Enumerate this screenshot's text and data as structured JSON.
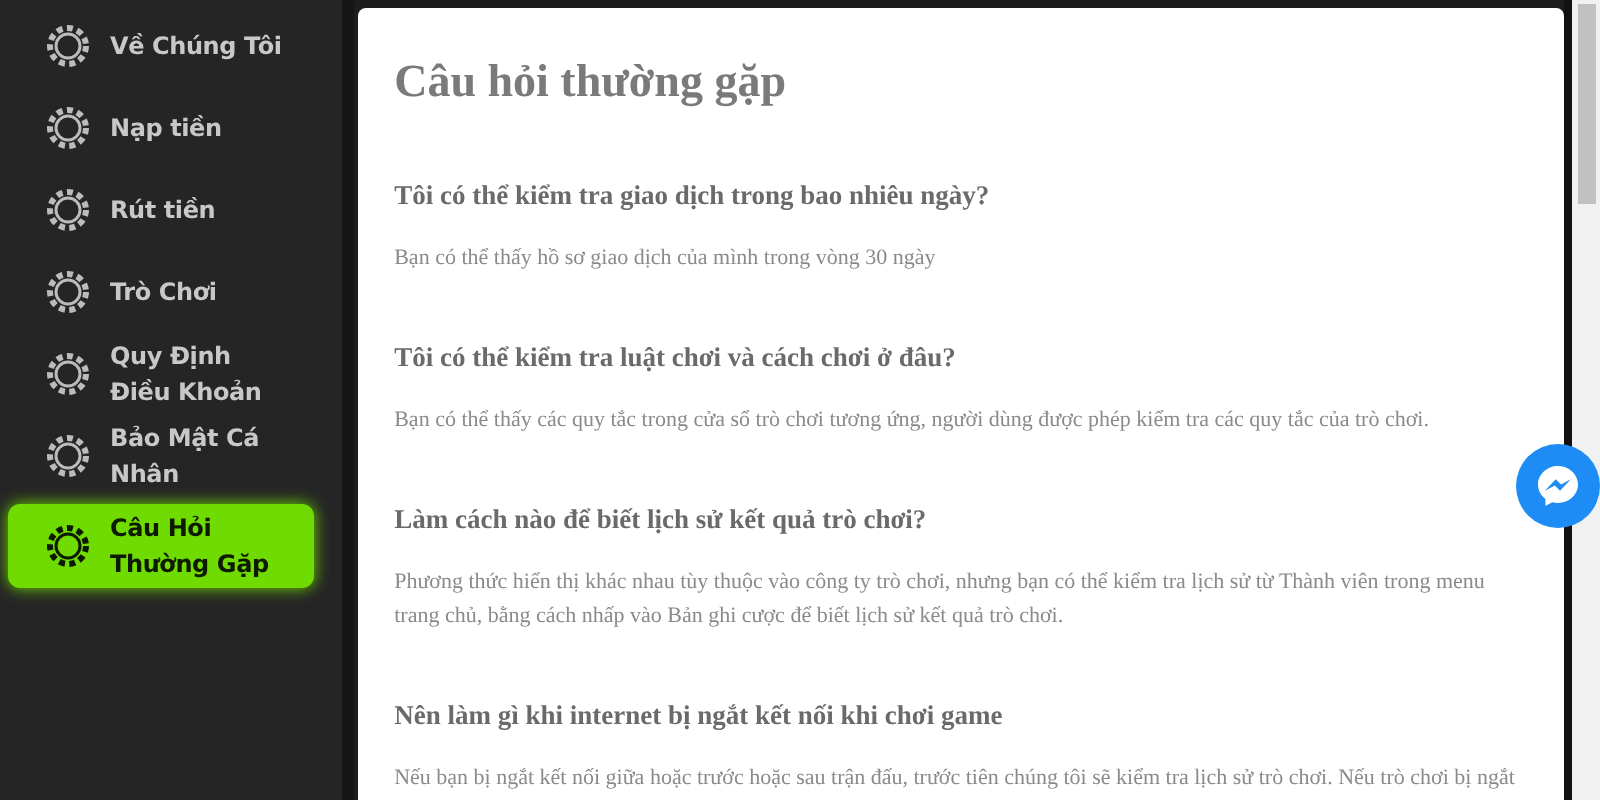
{
  "sidebar": {
    "items": [
      {
        "label": "Về Chúng Tôi",
        "selected": false
      },
      {
        "label": "Nạp tiền",
        "selected": false
      },
      {
        "label": "Rút tiền",
        "selected": false
      },
      {
        "label": "Trò Chơi",
        "selected": false
      },
      {
        "label": "Quy Định Điều Khoản",
        "selected": false
      },
      {
        "label": "Bảo Mật Cá Nhân",
        "selected": false
      },
      {
        "label": "Câu Hỏi Thường Gặp",
        "selected": true
      }
    ]
  },
  "content": {
    "title": "Câu hỏi thường gặp",
    "faqs": [
      {
        "question": "Tôi có thể kiểm tra giao dịch trong bao nhiêu ngày?",
        "answer": "Bạn có thể thấy hồ sơ giao dịch của mình trong vòng 30 ngày"
      },
      {
        "question": "Tôi có thể kiểm tra luật chơi và cách chơi ở đâu?",
        "answer": "Bạn có thể thấy các quy tắc trong cửa sổ trò chơi tương ứng, người dùng được phép kiểm tra các quy tắc của trò chơi."
      },
      {
        "question": "Làm cách nào để biết lịch sử kết quả trò chơi?",
        "answer": "Phương thức hiển thị khác nhau tùy thuộc vào công ty trò chơi, nhưng bạn có thể kiểm tra lịch sử từ Thành viên trong menu trang chủ, bằng cách nhấp vào Bản ghi cược để biết lịch sử kết quả trò chơi."
      },
      {
        "question": "Nên làm gì khi internet bị ngắt kết nối khi chơi game",
        "answer": "Nếu bạn bị ngắt kết nối giữa hoặc trước hoặc sau trận đấu, trước tiên chúng tôi sẽ kiểm tra lịch sử trò chơi. Nếu trò chơi bị ngắt"
      }
    ]
  }
}
